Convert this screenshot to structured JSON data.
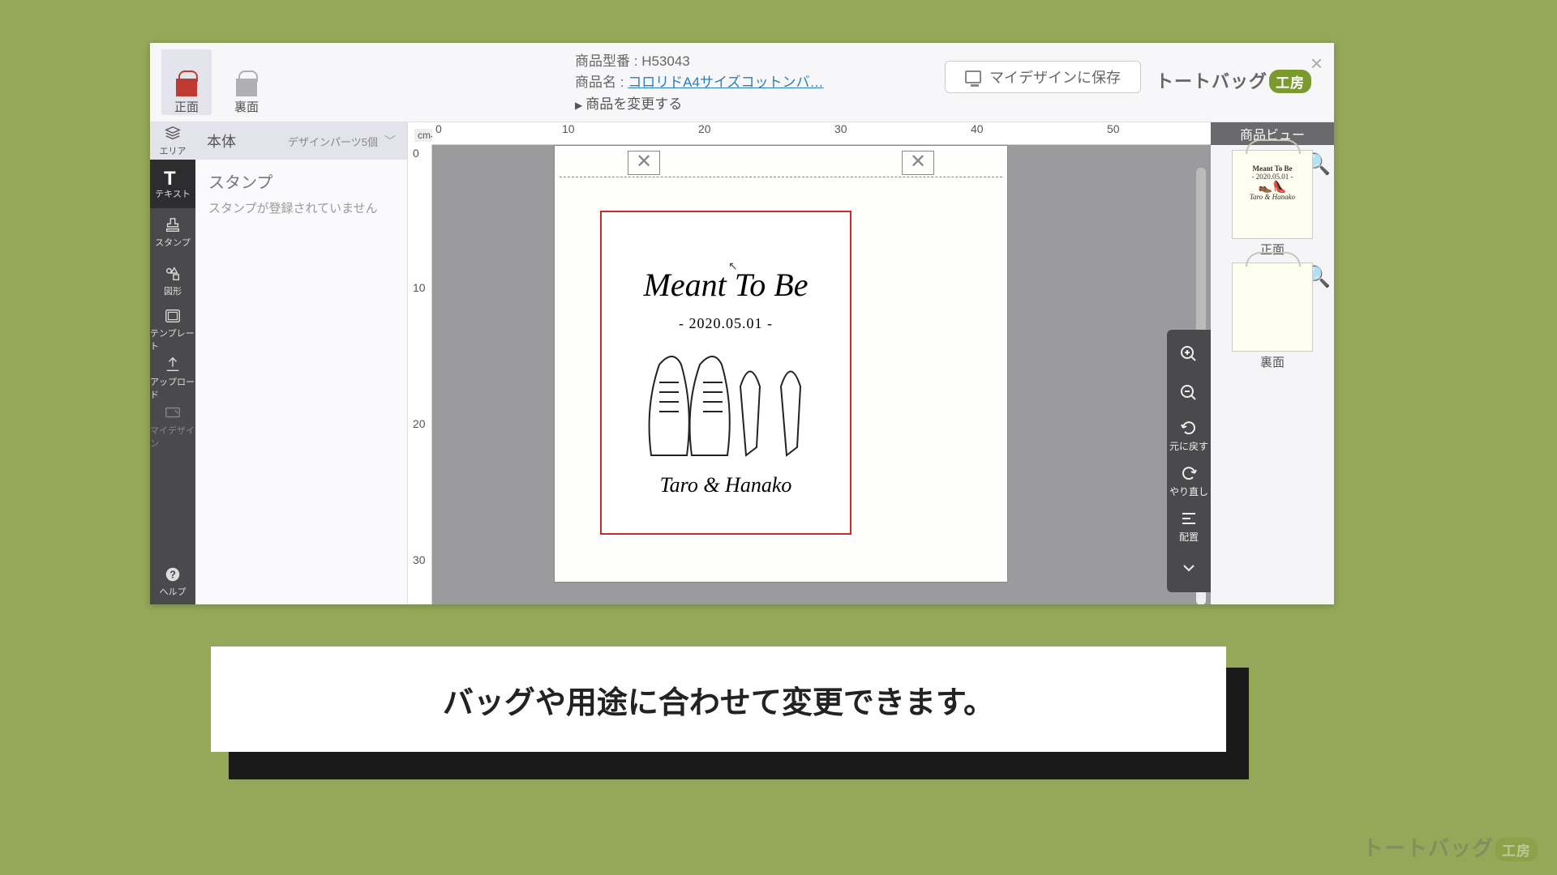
{
  "header": {
    "tabs": {
      "front": "正面",
      "back": "裏面"
    },
    "product_code_label": "商品型番 :",
    "product_code": "H53043",
    "product_name_label": "商品名 :",
    "product_name": "コロリドA4サイズコットンバ…",
    "change_product": "商品を変更する",
    "save_button": "マイデザインに保存",
    "brand_main": "トートバッグ",
    "brand_bubble": "工房"
  },
  "tools": {
    "area": "エリア",
    "text": "テキスト",
    "stamp": "スタンプ",
    "shape": "図形",
    "template": "テンプレート",
    "upload": "アップロード",
    "mydesign": "マイデザイン",
    "help": "ヘルプ"
  },
  "stamp_panel": {
    "body_label": "本体",
    "parts_count": "デザインパーツ5個",
    "title": "スタンプ",
    "empty": "スタンプが登録されていません"
  },
  "ruler": {
    "unit": "cm",
    "h": [
      "0",
      "10",
      "20",
      "30",
      "40",
      "50"
    ],
    "v": [
      "0",
      "10",
      "20",
      "30"
    ]
  },
  "design": {
    "main_text": "Meant To Be",
    "date": "- 2020.05.01 -",
    "names": "Taro & Hanako"
  },
  "float_tools": {
    "undo": "元に戻す",
    "redo": "やり直し",
    "align": "配置"
  },
  "preview": {
    "title": "商品ビュー",
    "front": "正面",
    "back": "裏面"
  },
  "caption": "バッグや用途に合わせて変更できます。"
}
